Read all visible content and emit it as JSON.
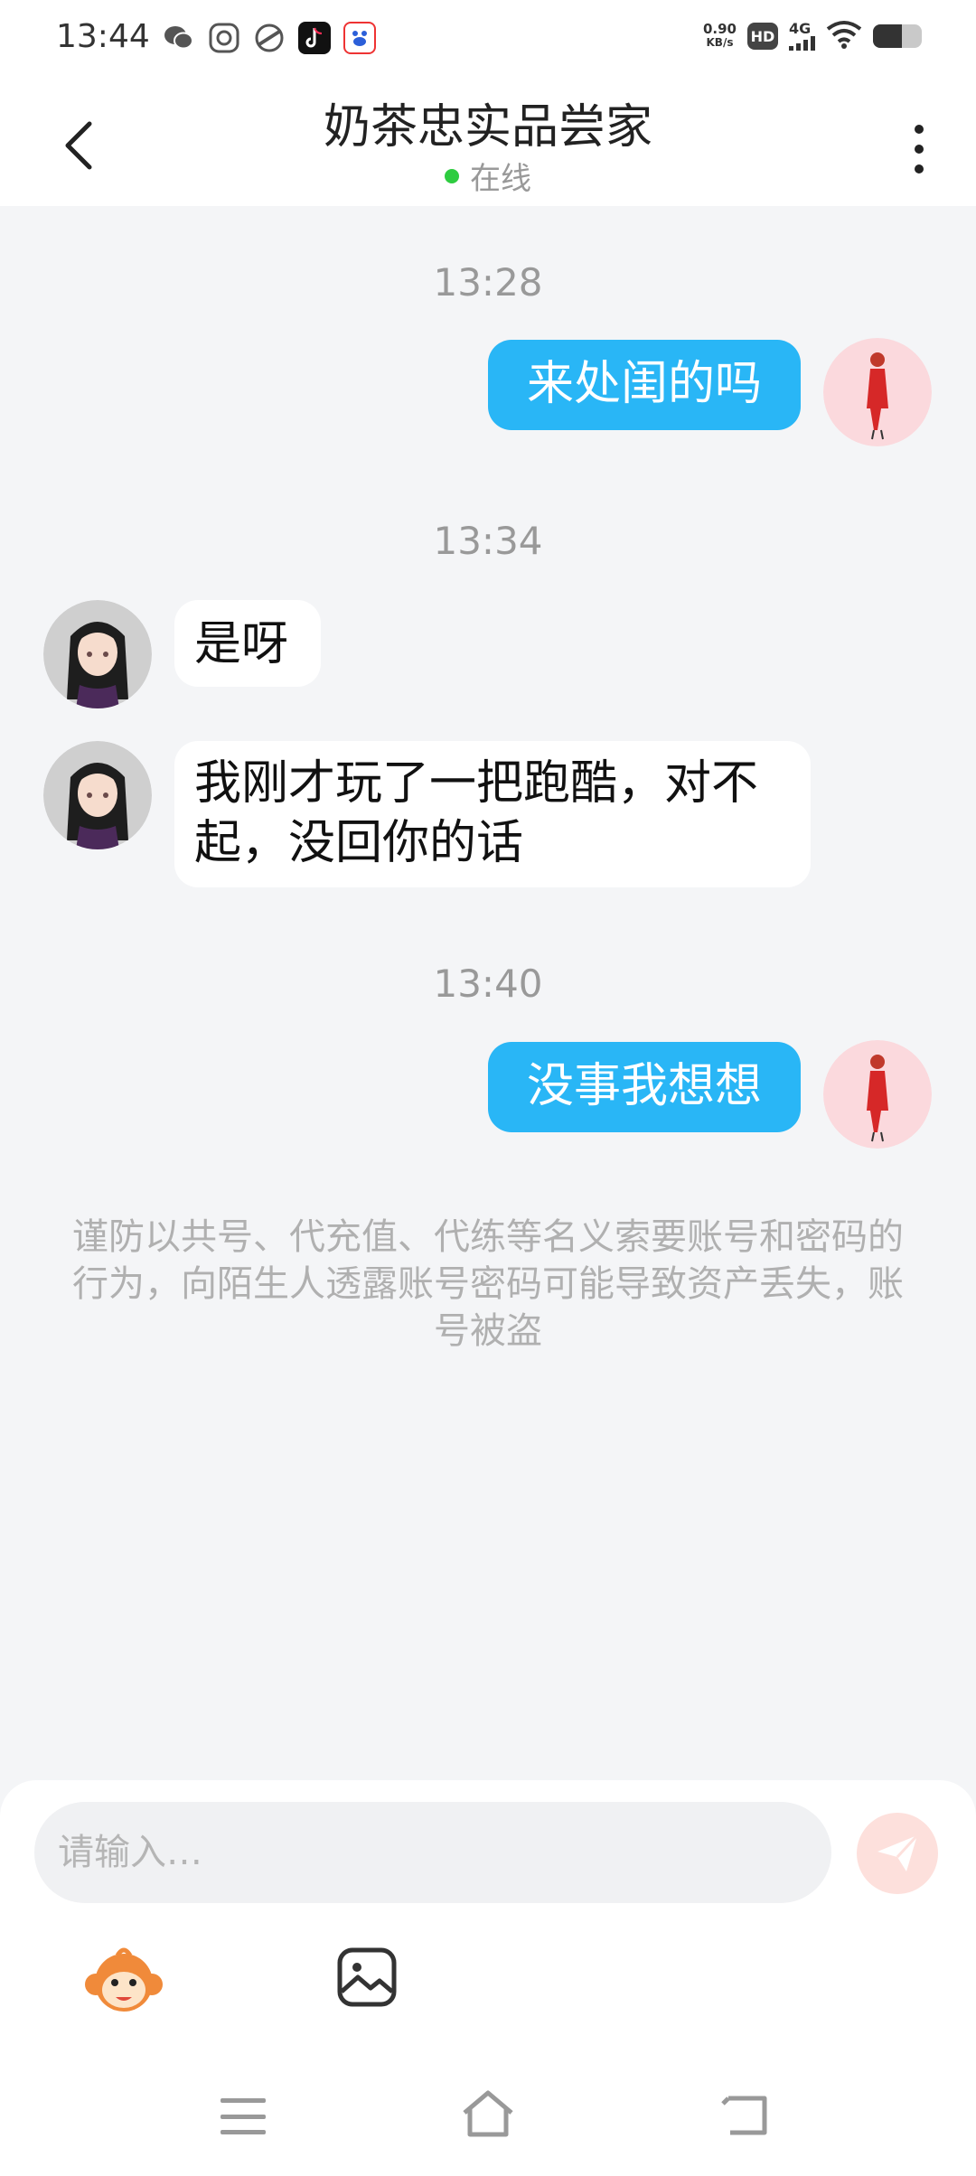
{
  "status_bar": {
    "time": "13:44",
    "net_speed_value": "0.90",
    "net_speed_unit": "KB/s",
    "hd": "HD",
    "network": "4G",
    "battery_level": 0.6,
    "app_icons": [
      "wechat-icon",
      "scan-app-icon",
      "gallery-app-icon",
      "tiktok-icon",
      "baidu-icon"
    ]
  },
  "header": {
    "title": "奶茶忠实品尝家",
    "status": "在线"
  },
  "messages": [
    {
      "type": "time",
      "text": "13:28"
    },
    {
      "type": "me",
      "text": "来处闺的吗"
    },
    {
      "type": "time",
      "text": "13:34"
    },
    {
      "type": "them",
      "text": "是呀"
    },
    {
      "type": "them",
      "text": "我刚才玩了一把跑酷，对不起，没回你的话"
    },
    {
      "type": "time",
      "text": "13:40"
    },
    {
      "type": "me",
      "text": "没事我想想"
    }
  ],
  "notice": "谨防以共号、代充值、代练等名义索要账号和密码的行为，向陌生人透露账号密码可能导致资产丢失，账号被盗",
  "input": {
    "placeholder": "请输入…",
    "value": ""
  },
  "colors": {
    "my_bubble": "#29b6f6",
    "their_bubble": "#ffffff",
    "background": "#f4f5f7",
    "online": "#2ecc40",
    "send_button": "#fde0dc"
  }
}
